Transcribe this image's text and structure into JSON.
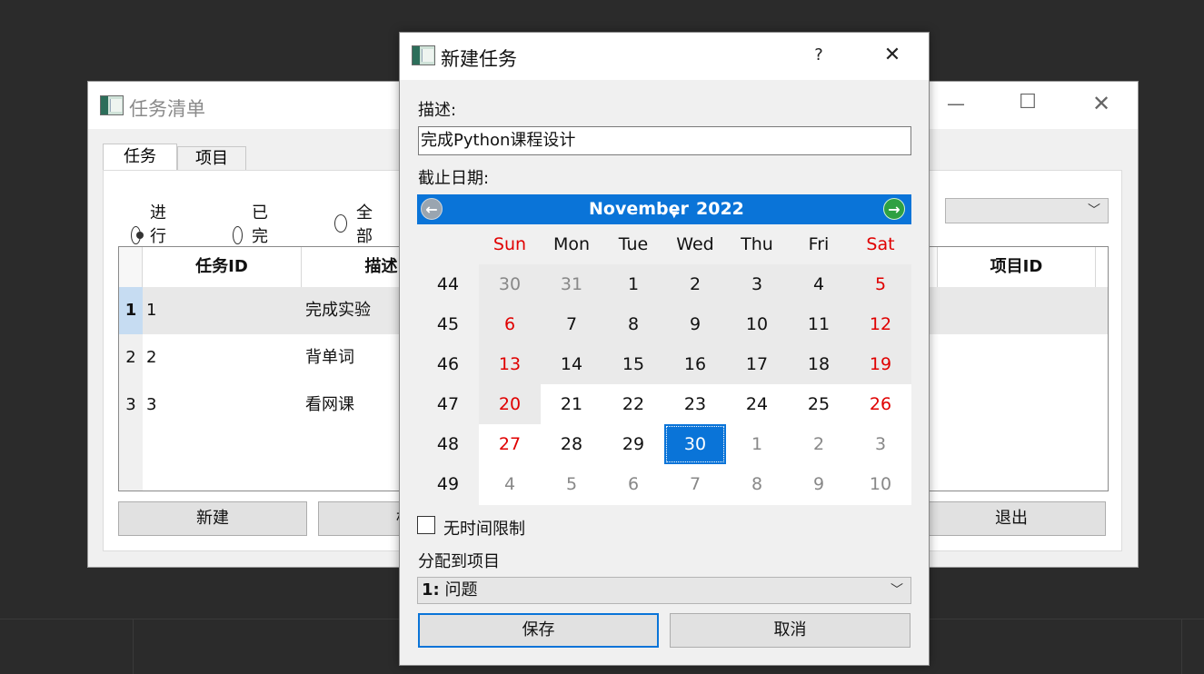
{
  "main_window": {
    "title": "任务清单",
    "tabs": [
      {
        "label": "任务"
      },
      {
        "label": "项目"
      }
    ],
    "filters": [
      {
        "label": "进行中",
        "checked": true
      },
      {
        "label": "已完成",
        "checked": false
      },
      {
        "label": "全部",
        "checked": false
      }
    ],
    "columns": {
      "task_id": "任务ID",
      "description": "描述",
      "project_id": "项目ID"
    },
    "rows": [
      {
        "header": "1",
        "task_id": "1",
        "description": "完成实验"
      },
      {
        "header": "2",
        "task_id": "2",
        "description": "背单词"
      },
      {
        "header": "3",
        "task_id": "3",
        "description": "看网课"
      }
    ],
    "buttons": {
      "new": "新建",
      "mark": "标记",
      "exit": "退出"
    }
  },
  "dialog": {
    "title": "新建任务",
    "help_glyph": "?",
    "description_label": "描述:",
    "description_value": "完成Python课程设计",
    "deadline_label": "截止日期:",
    "calendar": {
      "month": "November",
      "year": "2022",
      "day_headers": [
        "Sun",
        "Mon",
        "Tue",
        "Wed",
        "Thu",
        "Fri",
        "Sat"
      ],
      "weeks": [
        {
          "week": "44",
          "days": [
            "30",
            "31",
            "1",
            "2",
            "3",
            "4",
            "5"
          ]
        },
        {
          "week": "45",
          "days": [
            "6",
            "7",
            "8",
            "9",
            "10",
            "11",
            "12"
          ]
        },
        {
          "week": "46",
          "days": [
            "13",
            "14",
            "15",
            "16",
            "17",
            "18",
            "19"
          ]
        },
        {
          "week": "47",
          "days": [
            "20",
            "21",
            "22",
            "23",
            "24",
            "25",
            "26"
          ]
        },
        {
          "week": "48",
          "days": [
            "27",
            "28",
            "29",
            "30",
            "1",
            "2",
            "3"
          ]
        },
        {
          "week": "49",
          "days": [
            "4",
            "5",
            "6",
            "7",
            "8",
            "9",
            "10"
          ]
        }
      ],
      "selected_date": "2022-11-30"
    },
    "no_time_limit": {
      "label": "无时间限制",
      "checked": false
    },
    "assign_label": "分配到项目",
    "project_select": {
      "prefix": "1:",
      "value": "问题"
    },
    "buttons": {
      "save": "保存",
      "cancel": "取消"
    }
  },
  "colors": {
    "accent": "#0a74d8",
    "weekend": "#e00000",
    "prev_nav": "#9aa5b0",
    "next_nav": "#2ea043"
  }
}
